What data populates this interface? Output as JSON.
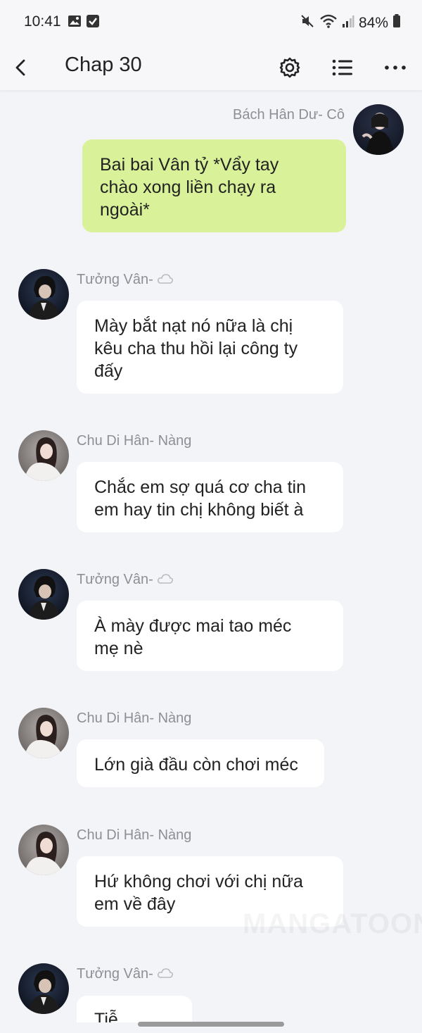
{
  "status_bar": {
    "time": "10:41",
    "battery": "84%",
    "icons": [
      "image-icon",
      "checkbox-icon",
      "mute-icon",
      "wifi-icon",
      "signal-icon",
      "battery-icon"
    ]
  },
  "app_bar": {
    "title": "Chap 30",
    "icons": [
      "back-arrow-icon",
      "gear-icon",
      "list-icon",
      "more-dots-icon"
    ]
  },
  "messages": [
    {
      "sender": "Bách Hân Dư- Cô",
      "side": "right",
      "avatar": "girl-dark-jacket",
      "lines": [
        "Bai bai Vân tỷ *Vẩy tay",
        "chào xong liền chạy ra",
        "ngoài*"
      ]
    },
    {
      "sender": "Tưởng Vân-",
      "side": "left",
      "avatar": "dark-portrait",
      "badge": "cloud-icon",
      "lines": [
        "Mày bắt nạt nó nữa là chị",
        "kêu cha thu hồi lại công ty",
        "đấy"
      ]
    },
    {
      "sender": "Chu Di Hân- Nàng",
      "side": "left",
      "avatar": "girl-white-dress",
      "lines": [
        "Chắc em sợ quá cơ cha tin",
        "em hay tin chị không biết à"
      ]
    },
    {
      "sender": "Tưởng Vân-",
      "side": "left",
      "avatar": "dark-portrait",
      "badge": "cloud-icon",
      "lines": [
        "À mày được mai tao méc",
        "mẹ nè"
      ]
    },
    {
      "sender": "Chu Di Hân- Nàng",
      "side": "left",
      "avatar": "girl-white-dress",
      "lines": [
        "Lớn già đầu còn chơi méc"
      ]
    },
    {
      "sender": "Chu Di Hân- Nàng",
      "side": "left",
      "avatar": "girl-white-dress",
      "lines": [
        "Hứ không chơi với chị nữa",
        "em về đây"
      ]
    },
    {
      "sender": "Tưởng Vân-",
      "side": "left",
      "avatar": "dark-portrait",
      "badge": "cloud-icon",
      "lines": [
        "Tiễ"
      ]
    }
  ],
  "watermark": "MANGATOON",
  "colors": {
    "background": "#f3f4f8",
    "my_bubble": "#d9f29a",
    "other_bubble": "#ffffff",
    "name_text": "#8c8f96"
  }
}
